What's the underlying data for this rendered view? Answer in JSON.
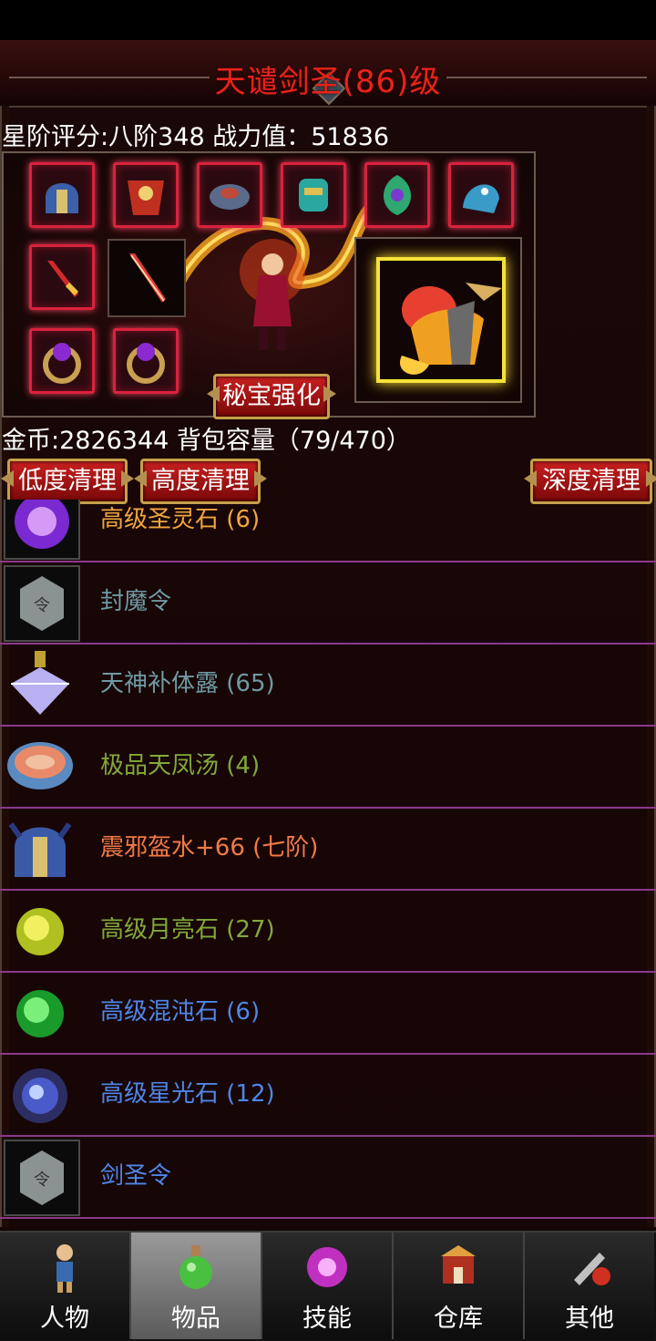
{
  "header": {
    "title": "天谴剑圣(86)级"
  },
  "stats": {
    "text": "星阶评分:八阶348 战力值：51836"
  },
  "equipment": {
    "slots": [
      {
        "icon": "helmet-icon"
      },
      {
        "icon": "armor-icon"
      },
      {
        "icon": "shoulder-icon"
      },
      {
        "icon": "jade-dragon-icon"
      },
      {
        "icon": "green-spirit-icon"
      },
      {
        "icon": "blue-beast-icon"
      },
      {
        "icon": "sword-icon"
      },
      {
        "icon": "weapon-slot-icon"
      },
      {
        "icon": "ring-left-icon"
      },
      {
        "icon": "ring-right-icon"
      }
    ],
    "secret_button": "秘宝强化",
    "pet": {
      "icon": "golden-beast-mount-icon"
    }
  },
  "inventory": {
    "gold_line": "金币:2826344 背包容量（79/470）",
    "clear_low": "低度清理",
    "clear_high": "高度清理",
    "clear_deep": "深度清理"
  },
  "items": [
    {
      "name": "高级圣灵石 (6)",
      "color": "#f0a640",
      "icon": "purple-spirit-stone-icon"
    },
    {
      "name": "封魔令",
      "color": "#6f9aa3",
      "icon": "seal-token-icon"
    },
    {
      "name": "天神补体露 (65)",
      "color": "#6f9aa3",
      "icon": "crystal-potion-icon"
    },
    {
      "name": "极品天凤汤 (4)",
      "color": "#82a83a",
      "icon": "phoenix-soup-bowl-icon"
    },
    {
      "name": "震邪盔水+66 (七阶)",
      "color": "#f07a46",
      "icon": "helmet-icon"
    },
    {
      "name": "高级月亮石 (27)",
      "color": "#82a83a",
      "icon": "moon-stone-icon"
    },
    {
      "name": "高级混沌石 (6)",
      "color": "#4f86e8",
      "icon": "chaos-stone-icon"
    },
    {
      "name": "高级星光石 (12)",
      "color": "#4f86e8",
      "icon": "starlight-stone-icon"
    },
    {
      "name": "剑圣令",
      "color": "#4f86e8",
      "icon": "sword-saint-token-icon"
    }
  ],
  "nav": {
    "tabs": [
      {
        "label": "人物",
        "icon": "character-icon",
        "active": false
      },
      {
        "label": "物品",
        "icon": "potion-bag-icon",
        "active": true
      },
      {
        "label": "技能",
        "icon": "skill-orb-icon",
        "active": false
      },
      {
        "label": "仓库",
        "icon": "warehouse-icon",
        "active": false
      },
      {
        "label": "其他",
        "icon": "other-tools-icon",
        "active": false
      }
    ]
  }
}
